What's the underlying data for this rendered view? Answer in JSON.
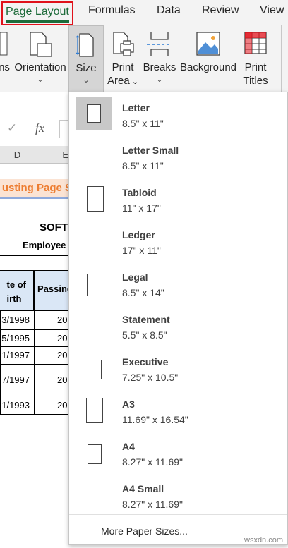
{
  "tabs": {
    "page_layout": "Page Layout",
    "formulas": "Formulas",
    "data": "Data",
    "review": "Review",
    "view": "View"
  },
  "ribbon": {
    "margins_partial": "ns",
    "orientation": "Orientation",
    "size": "Size",
    "print_area_1": "Print",
    "print_area_2": "Area",
    "breaks": "Breaks",
    "background": "Background",
    "print_titles_1": "Print",
    "print_titles_2": "Titles"
  },
  "formula_bar": {
    "cancel": "✓",
    "fx": "fx"
  },
  "columns": [
    "D",
    "E"
  ],
  "sheet": {
    "title_partial": "usting Page S",
    "company_partial": "SOFT",
    "subtitle_partial": "Employee",
    "header_a": "te of\nirth",
    "header_b": "Passing",
    "rows": [
      {
        "a": "3/1998",
        "b": "202"
      },
      {
        "a": "5/1995",
        "b": "201"
      },
      {
        "a": "11/1997",
        "b": "202"
      },
      {
        "a": "7/1997",
        "b": "202"
      },
      {
        "a": "1/1993",
        "b": "201"
      }
    ]
  },
  "paper_sizes": [
    {
      "name": "Letter",
      "dim": "8.5\" x 11\"",
      "selected": true
    },
    {
      "name": "Letter Small",
      "dim": "8.5\" x 11\"",
      "selected": false
    },
    {
      "name": "Tabloid",
      "dim": "11\" x 17\"",
      "selected": false
    },
    {
      "name": "Ledger",
      "dim": "17\" x 11\"",
      "selected": false
    },
    {
      "name": "Legal",
      "dim": "8.5\" x 14\"",
      "selected": false
    },
    {
      "name": "Statement",
      "dim": "5.5\" x 8.5\"",
      "selected": false
    },
    {
      "name": "Executive",
      "dim": "7.25\" x 10.5\"",
      "selected": false
    },
    {
      "name": "A3",
      "dim": "11.69\" x 16.54\"",
      "selected": false
    },
    {
      "name": "A4",
      "dim": "8.27\" x 11.69\"",
      "selected": false
    },
    {
      "name": "A4 Small",
      "dim": "8.27\" x 11.69\"",
      "selected": false
    }
  ],
  "more_paper_sizes": "More Paper Sizes...",
  "watermark": "wsxdn.com",
  "colors": {
    "accent_green": "#1d6b3a",
    "highlight_red": "#e0121b",
    "title_orange": "#ed7d31"
  }
}
